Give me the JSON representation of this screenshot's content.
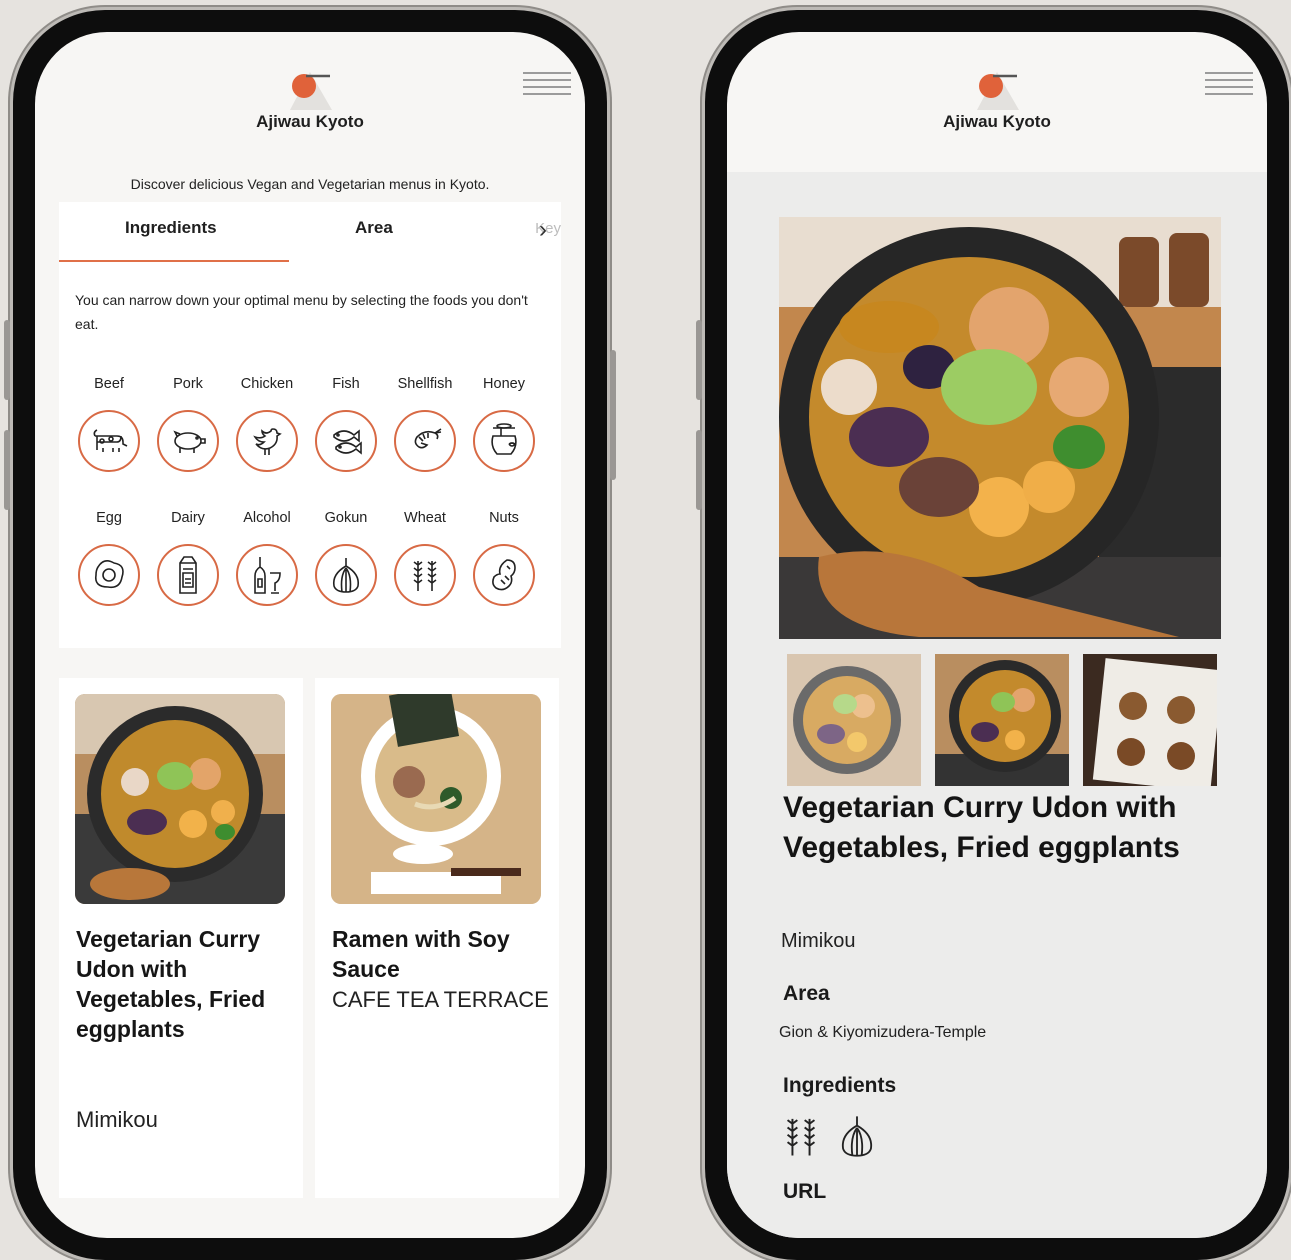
{
  "app": {
    "title": "Ajiwau Kyoto"
  },
  "left": {
    "tagline": "Discover delicious Vegan and Vegetarian menus in Kyoto.",
    "tabs": [
      {
        "label": "Ingredients",
        "active": true
      },
      {
        "label": "Area",
        "active": false
      }
    ],
    "tab_peek": "Key",
    "description": "You can narrow down your optimal menu by selecting the foods you don't eat.",
    "foods": [
      {
        "label": "Beef",
        "icon": "cow-icon"
      },
      {
        "label": "Pork",
        "icon": "pig-icon"
      },
      {
        "label": "Chicken",
        "icon": "chicken-icon"
      },
      {
        "label": "Fish",
        "icon": "fish-icon"
      },
      {
        "label": "Shellfish",
        "icon": "shrimp-icon"
      },
      {
        "label": "Honey",
        "icon": "honey-pot-icon"
      },
      {
        "label": "Egg",
        "icon": "fried-egg-icon"
      },
      {
        "label": "Dairy",
        "icon": "milk-carton-icon"
      },
      {
        "label": "Alcohol",
        "icon": "wine-bottle-glass-icon"
      },
      {
        "label": "Gokun",
        "icon": "garlic-icon"
      },
      {
        "label": "Wheat",
        "icon": "wheat-icon"
      },
      {
        "label": "Nuts",
        "icon": "peanut-icon"
      }
    ],
    "cards": [
      {
        "title": "Vegetarian Curry Udon with Vegetables, Fried eggplants",
        "place": "Mimikou"
      },
      {
        "title": "Ramen with Soy Sauce",
        "place": "CAFE TEA TERRACE"
      }
    ]
  },
  "right": {
    "title": "Vegetarian Curry Udon with Vegetables, Fried eggplants",
    "restaurant": "Mimikou",
    "area_label": "Area",
    "area_value": "Gion & Kiyomizudera-Temple",
    "ingredients_label": "Ingredients",
    "ingredient_icons": [
      "wheat-icon",
      "garlic-icon"
    ],
    "url_label": "URL"
  },
  "colors": {
    "accent": "#e07048",
    "background": "#e6e3df",
    "screen": "#f7f6f4"
  }
}
